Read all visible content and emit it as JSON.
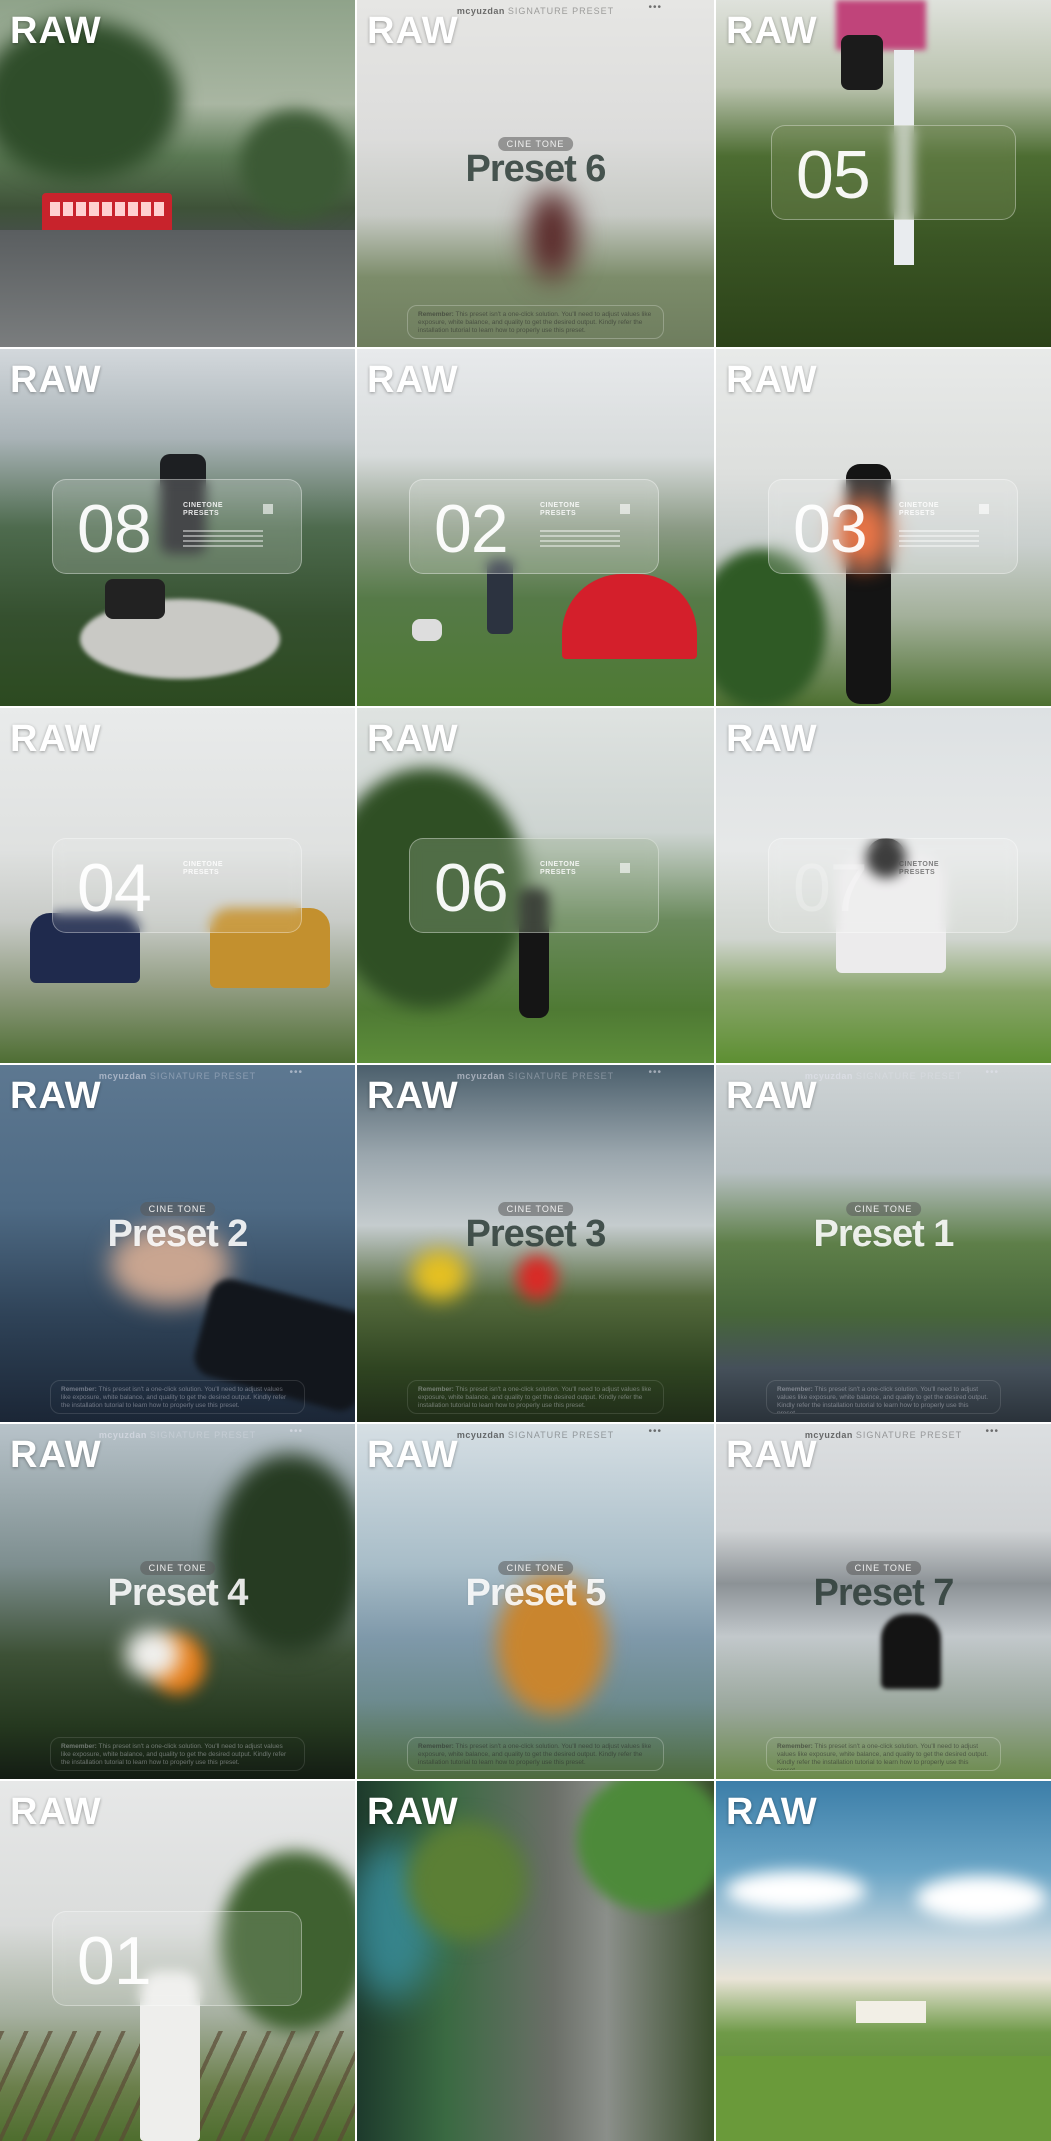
{
  "gallery": {
    "raw_label": "RAW",
    "tiles": [
      {
        "id": "t1",
        "kind": "photo",
        "raw": "RAW"
      },
      {
        "id": "t2",
        "kind": "preset",
        "raw": "RAW",
        "brand": "mcyuzdan",
        "signature": "SIGNATURE PRESET",
        "badge": "CINE TONE",
        "title": "Preset 6",
        "title_tone": "dark"
      },
      {
        "id": "t3",
        "kind": "number",
        "raw": "RAW",
        "number": "05"
      },
      {
        "id": "t4",
        "kind": "number",
        "raw": "RAW",
        "number": "08"
      },
      {
        "id": "t5",
        "kind": "number",
        "raw": "RAW",
        "number": "02"
      },
      {
        "id": "t6",
        "kind": "number",
        "raw": "RAW",
        "number": "03"
      },
      {
        "id": "t7",
        "kind": "number",
        "raw": "RAW",
        "number": "04"
      },
      {
        "id": "t8",
        "kind": "number",
        "raw": "RAW",
        "number": "06"
      },
      {
        "id": "t9",
        "kind": "number",
        "raw": "RAW",
        "number": "07"
      },
      {
        "id": "t10",
        "kind": "preset",
        "raw": "RAW",
        "brand": "mcyuzdan",
        "signature": "SIGNATURE PRESET",
        "badge": "CINE TONE",
        "title": "Preset 2",
        "title_tone": "light"
      },
      {
        "id": "t11",
        "kind": "preset",
        "raw": "RAW",
        "brand": "mcyuzdan",
        "signature": "SIGNATURE PRESET",
        "badge": "CINE TONE",
        "title": "Preset 3",
        "title_tone": "dark"
      },
      {
        "id": "t12",
        "kind": "preset",
        "raw": "RAW",
        "brand": "mcyuzdan",
        "signature": "SIGNATURE PRESET",
        "badge": "CINE TONE",
        "title": "Preset 1",
        "title_tone": "light"
      },
      {
        "id": "t13",
        "kind": "preset",
        "raw": "RAW",
        "brand": "mcyuzdan",
        "signature": "SIGNATURE PRESET",
        "badge": "CINE TONE",
        "title": "Preset 4",
        "title_tone": "light"
      },
      {
        "id": "t14",
        "kind": "preset",
        "raw": "RAW",
        "brand": "mcyuzdan",
        "signature": "SIGNATURE PRESET",
        "badge": "CINE TONE",
        "title": "Preset 5",
        "title_tone": "light"
      },
      {
        "id": "t15",
        "kind": "preset",
        "raw": "RAW",
        "brand": "mcyuzdan",
        "signature": "SIGNATURE PRESET",
        "badge": "CINE TONE",
        "title": "Preset 7",
        "title_tone": "dark"
      },
      {
        "id": "t16",
        "kind": "number",
        "raw": "RAW",
        "number": "01"
      },
      {
        "id": "t17",
        "kind": "photo",
        "raw": "RAW"
      },
      {
        "id": "t18",
        "kind": "photo",
        "raw": "RAW"
      }
    ],
    "mini_card_text": "CINETONE\nPRESETS",
    "remember_lead": "Remember:",
    "remember_body": "This preset isn't a one-click solution. You'll need to adjust values like exposure, white balance, and quality to get the desired output. Kindly refer the installation tutorial to learn how to properly use this preset."
  }
}
